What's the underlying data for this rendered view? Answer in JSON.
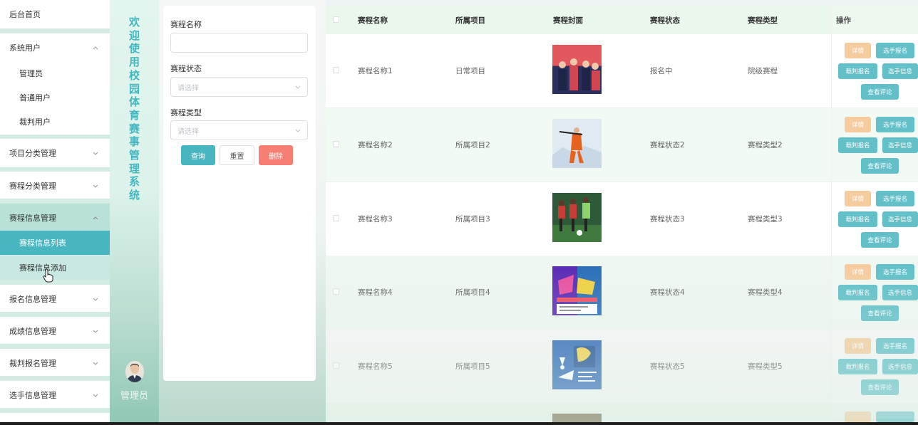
{
  "sidebar": {
    "home": "后台首页",
    "system_users": {
      "label": "系统用户",
      "items": [
        "管理员",
        "普通用户",
        "裁判用户"
      ]
    },
    "project_category": "项目分类管理",
    "event_category": "赛程分类管理",
    "event_info": {
      "label": "赛程信息管理",
      "items": [
        "赛程信息列表",
        "赛程信息添加"
      ]
    },
    "signup_info": "报名信息管理",
    "score_info": "成绩信息管理",
    "referee_signup": "裁判报名管理",
    "player_info": "选手信息管理"
  },
  "welcome": {
    "title": "欢迎使用校园体育赛事管理系统",
    "admin": "管理员"
  },
  "search": {
    "name_label": "赛程名称",
    "name_value": "",
    "status_label": "赛程状态",
    "status_placeholder": "请选择",
    "type_label": "赛程类型",
    "type_placeholder": "请选择",
    "query": "查询",
    "reset": "重置",
    "delete": "删除"
  },
  "table": {
    "headers": [
      "赛程名称",
      "所属项目",
      "赛程封面",
      "赛程状态",
      "赛程类型",
      "操作"
    ],
    "actions": {
      "detail": "详情",
      "player_signup": "选手报名",
      "referee_signup": "裁判报名",
      "player_info": "选手信息",
      "view_comments": "查看评论"
    },
    "rows": [
      {
        "name": "赛程名称1",
        "project": "日常项目",
        "status": "报名中",
        "type": "院级赛程"
      },
      {
        "name": "赛程名称2",
        "project": "所属项目2",
        "status": "赛程状态2",
        "type": "赛程类型2"
      },
      {
        "name": "赛程名称3",
        "project": "所属项目3",
        "status": "赛程状态3",
        "type": "赛程类型3"
      },
      {
        "name": "赛程名称4",
        "project": "所属项目4",
        "status": "赛程状态4",
        "type": "赛程类型4"
      },
      {
        "name": "赛程名称5",
        "project": "所属项目5",
        "status": "赛程状态5",
        "type": "赛程类型5"
      }
    ]
  },
  "colors": {
    "accent": "#48b6c0",
    "detail": "#f5c48e",
    "danger": "#f67e73",
    "header_bg": "#eaf7ec"
  }
}
